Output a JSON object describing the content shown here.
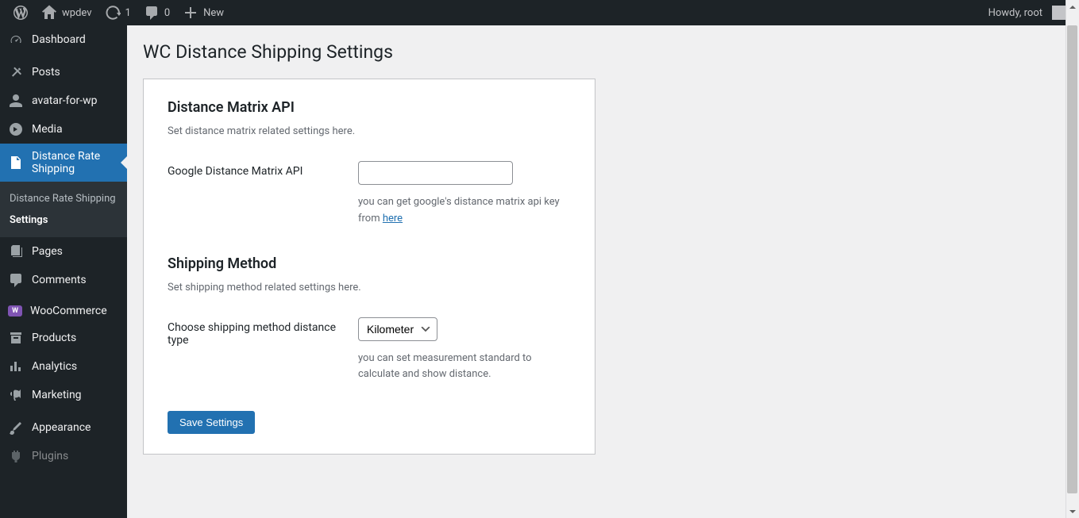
{
  "adminbar": {
    "site_name": "wpdev",
    "updates_count": "1",
    "comments_count": "0",
    "new_label": "New",
    "howdy": "Howdy, root"
  },
  "sidebar": {
    "items": [
      {
        "label": "Dashboard"
      },
      {
        "label": "Posts"
      },
      {
        "label": "avatar-for-wp"
      },
      {
        "label": "Media"
      },
      {
        "label": "Distance Rate Shipping"
      },
      {
        "label": "Pages"
      },
      {
        "label": "Comments"
      },
      {
        "label": "WooCommerce"
      },
      {
        "label": "Products"
      },
      {
        "label": "Analytics"
      },
      {
        "label": "Marketing"
      },
      {
        "label": "Appearance"
      },
      {
        "label": "Plugins"
      }
    ],
    "submenu": [
      {
        "label": "Distance Rate Shipping"
      },
      {
        "label": "Settings"
      }
    ]
  },
  "page": {
    "title": "WC Distance Shipping Settings",
    "section1": {
      "title": "Distance Matrix API",
      "desc": "Set distance matrix related settings here.",
      "field_label": "Google Distance Matrix API",
      "field_value": "",
      "help_text_before": "you can get google's distance matrix api key from ",
      "help_link": "here"
    },
    "section2": {
      "title": "Shipping Method",
      "desc": "Set shipping method related settings here.",
      "field_label": "Choose shipping method distance type",
      "select_value": "Kilometer",
      "help_text": "you can set measurement standard to calculate and show distance."
    },
    "save_button": "Save Settings"
  }
}
